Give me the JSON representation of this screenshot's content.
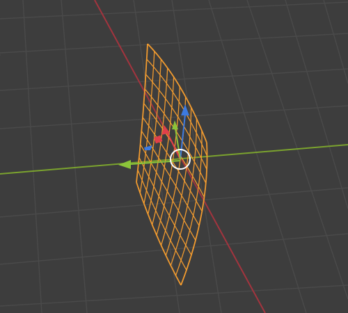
{
  "viewport": {
    "background_color": "#3d3d3d",
    "grid_color": "#4a4a4a",
    "x_axis_color": "#a3343e",
    "y_axis_color": "#7ba32e",
    "selected_wire_color": "#f29b2f",
    "view": "perspective"
  },
  "selection": {
    "object_type": "surface",
    "display": "wireframe",
    "selected": true
  },
  "gizmo": {
    "mode": "translate",
    "handles": [
      {
        "axis": "X",
        "color": "#e0404a",
        "icon": "arrow-x-icon"
      },
      {
        "axis": "Y",
        "color": "#8bc43a",
        "icon": "arrow-y-icon"
      },
      {
        "axis": "Z",
        "color": "#3d7ae0",
        "icon": "arrow-z-icon"
      }
    ],
    "pivot_color": "#ffffff"
  },
  "icons": [
    "origin-pivot-icon",
    "move-gizmo-icon"
  ]
}
